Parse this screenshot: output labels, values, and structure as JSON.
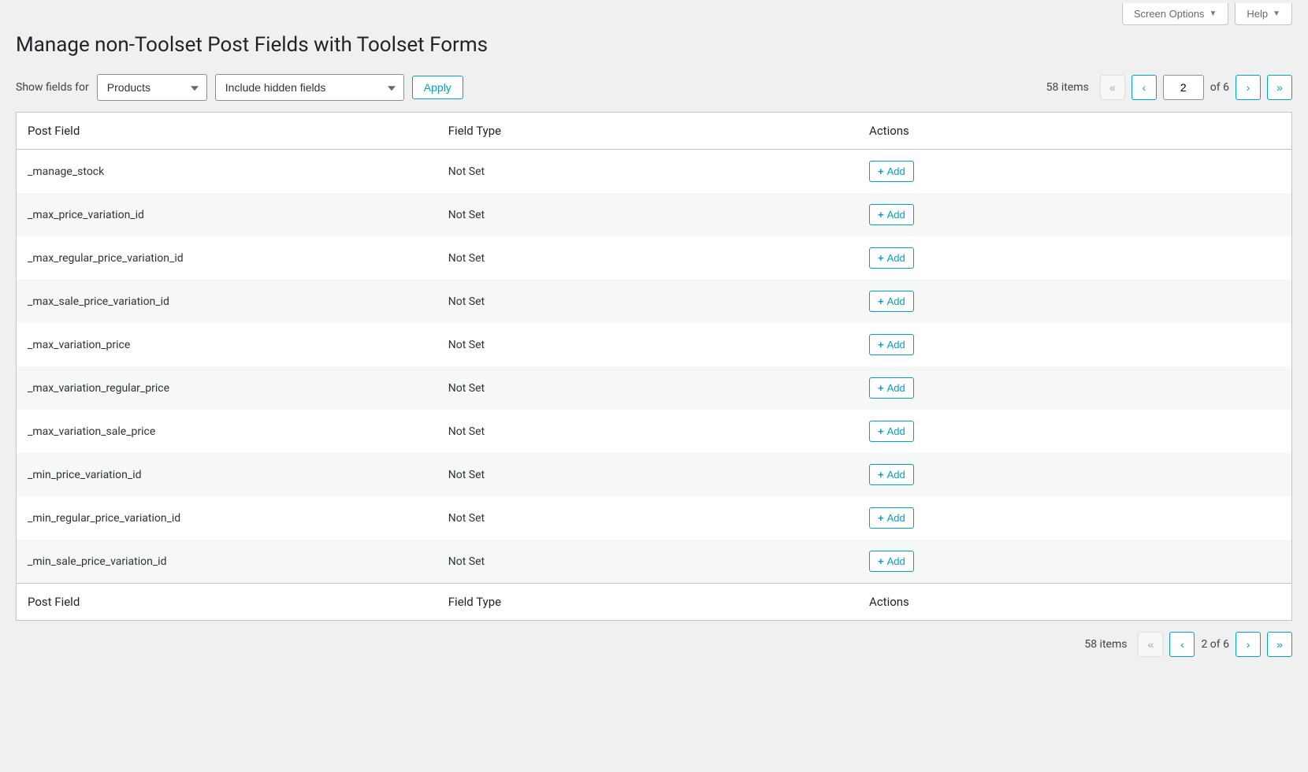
{
  "topTabs": {
    "screenOptions": "Screen Options",
    "help": "Help"
  },
  "pageTitle": "Manage non-Toolset Post Fields with Toolset Forms",
  "filter": {
    "label": "Show fields for",
    "postTypeSelected": "Products",
    "hiddenSelected": "Include hidden fields",
    "applyLabel": "Apply"
  },
  "paginationTop": {
    "itemsText": "58 items",
    "currentPage": "2",
    "ofText": "of 6"
  },
  "paginationBottom": {
    "itemsText": "58 items",
    "pageText": "2 of 6"
  },
  "table": {
    "headers": {
      "postField": "Post Field",
      "fieldType": "Field Type",
      "actions": "Actions"
    },
    "addLabel": "Add",
    "rows": [
      {
        "name": "_manage_stock",
        "type": "Not Set"
      },
      {
        "name": "_max_price_variation_id",
        "type": "Not Set"
      },
      {
        "name": "_max_regular_price_variation_id",
        "type": "Not Set"
      },
      {
        "name": "_max_sale_price_variation_id",
        "type": "Not Set"
      },
      {
        "name": "_max_variation_price",
        "type": "Not Set"
      },
      {
        "name": "_max_variation_regular_price",
        "type": "Not Set"
      },
      {
        "name": "_max_variation_sale_price",
        "type": "Not Set"
      },
      {
        "name": "_min_price_variation_id",
        "type": "Not Set"
      },
      {
        "name": "_min_regular_price_variation_id",
        "type": "Not Set"
      },
      {
        "name": "_min_sale_price_variation_id",
        "type": "Not Set"
      }
    ]
  }
}
